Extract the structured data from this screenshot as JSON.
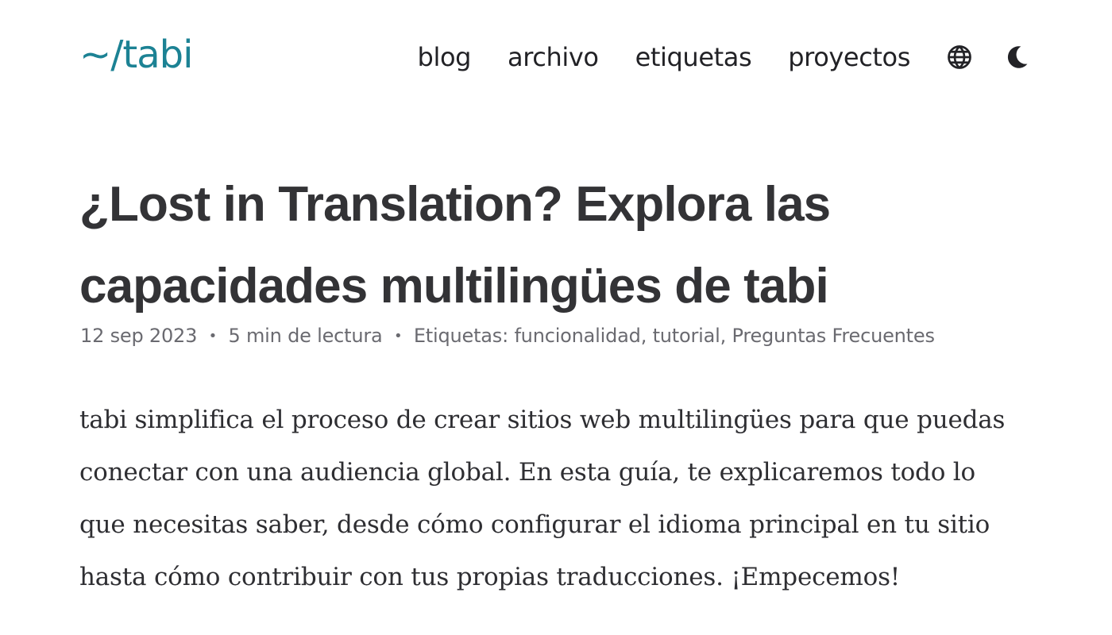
{
  "site": {
    "title": "~/tabi"
  },
  "nav": {
    "items": [
      {
        "label": "blog"
      },
      {
        "label": "archivo"
      },
      {
        "label": "etiquetas"
      },
      {
        "label": "proyectos"
      }
    ],
    "language_icon": "globe-icon",
    "theme_icon": "moon-icon"
  },
  "article": {
    "title": "¿Lost in Translation? Explora las capacidades multilingües de tabi",
    "meta": {
      "date": "12 sep 2023",
      "separator": "•",
      "reading_time": "5 min de lectura",
      "tags_label": "Etiquetas:",
      "tags": [
        "funcionalidad",
        "tutorial",
        "Preguntas Frecuentes"
      ],
      "tag_separator": ","
    },
    "body": "tabi simplifica el proceso de crear sitios web multilingües para que puedas conectar con una audiencia global. En esta guía, te explicaremos todo lo que necesitas saber, desde cómo configurar el idioma principal en tu sitio hasta cómo contribuir con tus propias traducciones. ¡Empecemos!"
  },
  "colors": {
    "accent": "#1c8294",
    "text": "#222226",
    "meta": "#6a6a70",
    "background": "#ffffff"
  }
}
